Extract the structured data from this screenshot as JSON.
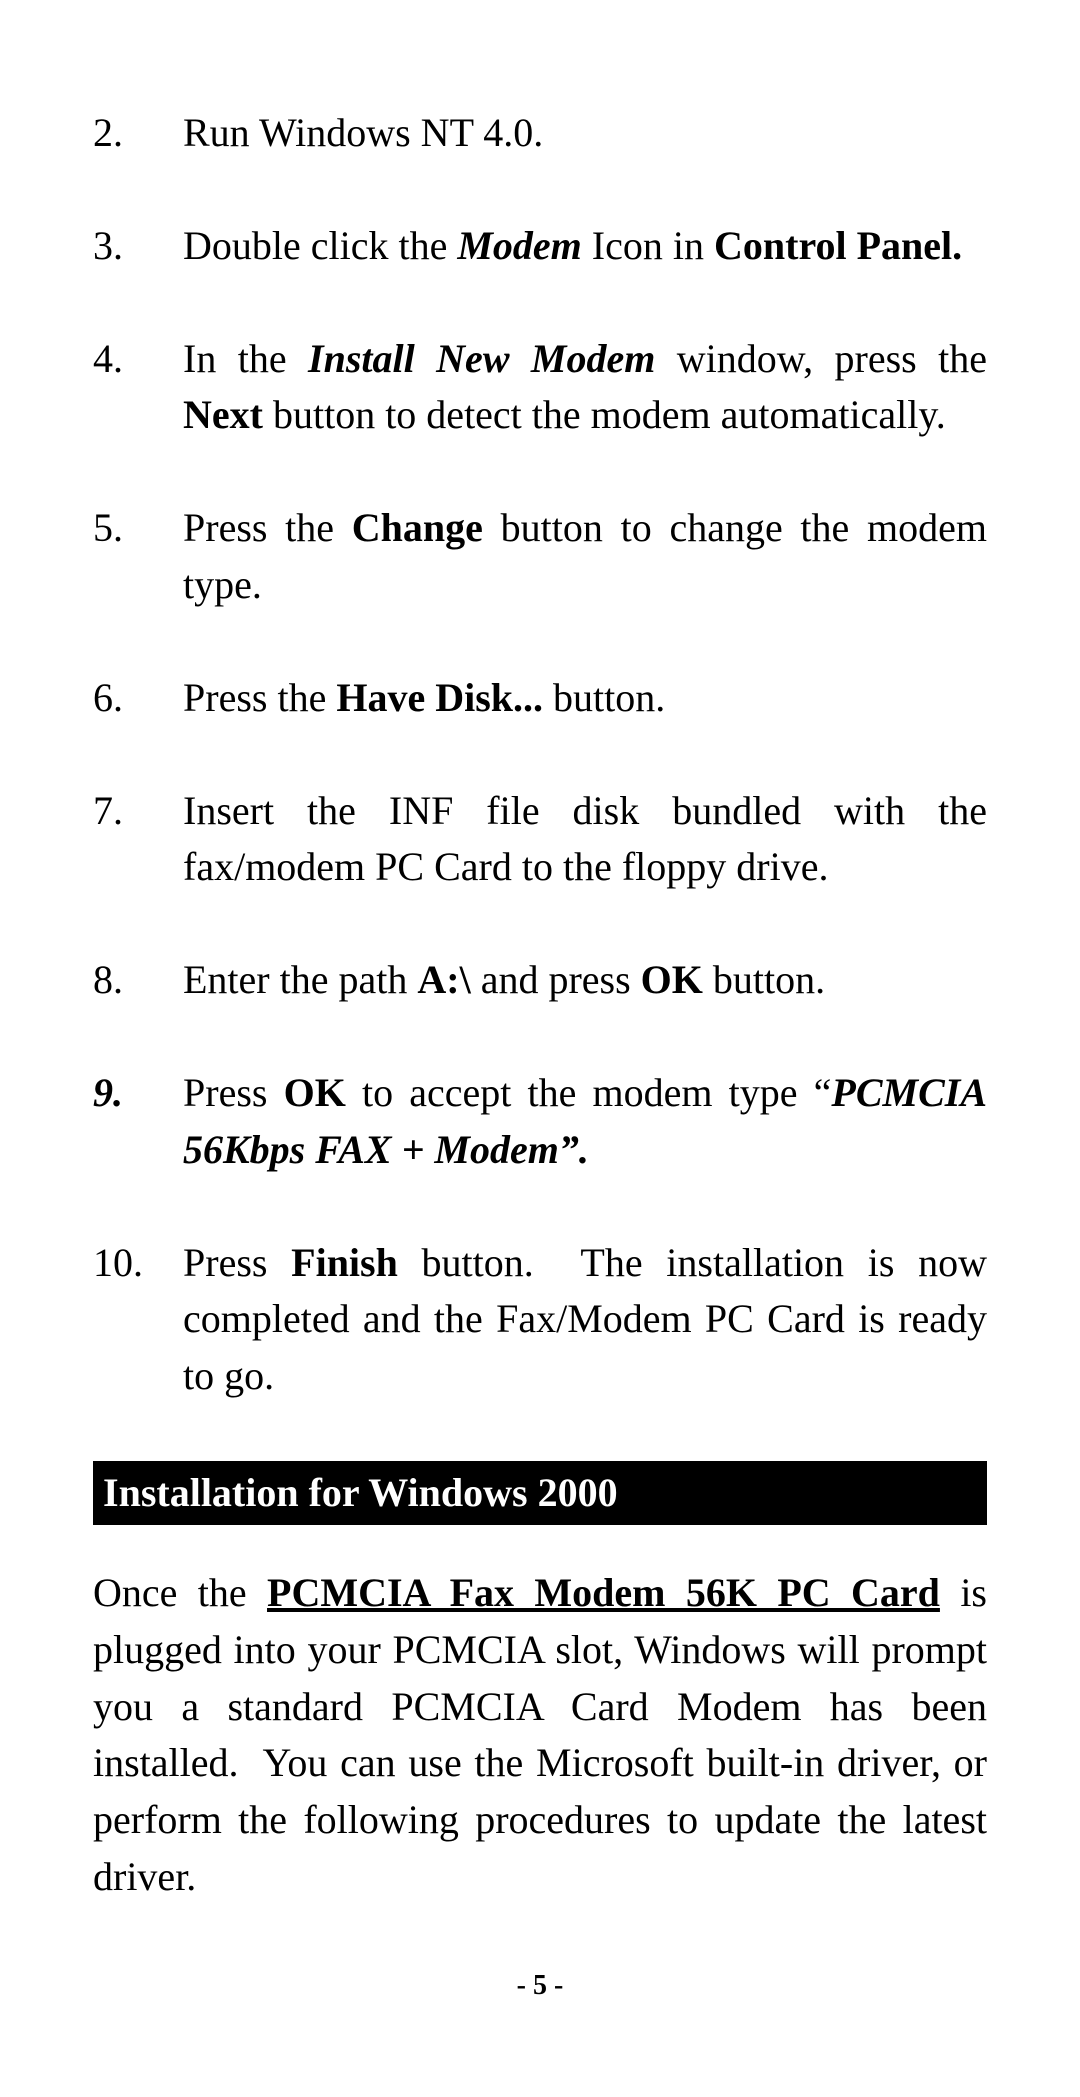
{
  "steps": [
    {
      "num": "2.",
      "html": "Run Windows NT 4.0."
    },
    {
      "num": "3.",
      "html": "Double click the <span class=\"bi\">Modem</span> Icon in <b>Control Panel.</b>"
    },
    {
      "num": "4.",
      "html": "In the <span class=\"bi\">Install New Modem</span> window, press the <b>Next</b> button to detect the modem automatically."
    },
    {
      "num": "5.",
      "html": "Press the <b>Change</b> button to change the modem type."
    },
    {
      "num": "6.",
      "html": "Press the <b>Have Disk...</b> button."
    },
    {
      "num": "7.",
      "html": "Insert the INF file disk bundled with the fax/modem PC Card to the floppy drive."
    },
    {
      "num": "8.",
      "html": "Enter the path <b>A:\\</b> and press <b>OK</b> button."
    },
    {
      "num": "9.",
      "italicNum": true,
      "html": "Press <b>OK</b> to accept the modem type &ldquo;<span class=\"bi\">PCMCIA 56Kbps FAX + Modem&rdquo;.</span>"
    },
    {
      "num": "10.",
      "html": "Press <b>Finish</b> button.&nbsp; The installation is now completed and the Fax/Modem PC Card is ready to go."
    }
  ],
  "section_heading": "Installation for Windows 2000",
  "paragraph_html": "Once the <span class=\"bu\">PCMCIA Fax Modem 56K PC Card</span> is plugged into your PCMCIA slot, Windows will prompt you a standard PCMCIA Card Modem has been installed.&nbsp; You can use the Microsoft built-in driver, or perform the following procedures to update the latest driver.",
  "page_number": "- 5 -"
}
